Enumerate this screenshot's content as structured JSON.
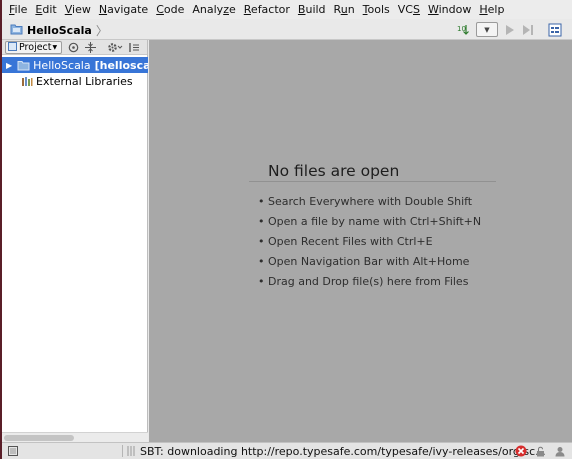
{
  "menu": [
    {
      "mnemonic": "F",
      "rest": "ile"
    },
    {
      "mnemonic": "E",
      "rest": "dit"
    },
    {
      "mnemonic": "V",
      "rest": "iew"
    },
    {
      "mnemonic": "N",
      "rest": "avigate"
    },
    {
      "mnemonic": "C",
      "rest": "ode"
    },
    {
      "pre": "Analy",
      "mnemonic": "z",
      "rest": "e"
    },
    {
      "mnemonic": "R",
      "rest": "efactor"
    },
    {
      "mnemonic": "B",
      "rest": "uild"
    },
    {
      "pre": "R",
      "mnemonic": "u",
      "rest": "n"
    },
    {
      "mnemonic": "T",
      "rest": "ools"
    },
    {
      "pre": "VC",
      "mnemonic": "S",
      "rest": ""
    },
    {
      "mnemonic": "W",
      "rest": "indow"
    },
    {
      "mnemonic": "H",
      "rest": "elp"
    }
  ],
  "navbar": {
    "breadcrumb": "HelloScala",
    "toolbar_icons": [
      "sort-icon",
      "run-config-dropdown",
      "run-icon",
      "debug-icon",
      "structure-icon"
    ]
  },
  "project_panel": {
    "view_selector": "Project",
    "tree": [
      {
        "label": "HelloScala",
        "module": "[helloscala",
        "selected": true,
        "expanded": false
      },
      {
        "label": "External Libraries",
        "selected": false
      }
    ]
  },
  "editor": {
    "title": "No files are open",
    "hints": [
      "• Search Everywhere with Double Shift",
      "• Open a file by name with Ctrl+Shift+N",
      "• Open Recent Files with Ctrl+E",
      "• Open Navigation Bar with Alt+Home",
      "• Drag and Drop file(s) here from Files"
    ]
  },
  "statusbar": {
    "message": "SBT: downloading http://repo.typesafe.com/typesafe/ivy-releases/org.sc..."
  },
  "colors": {
    "selection": "#3875d7",
    "editor_bg": "#a8a8a8",
    "window_frame": "#5a1e28",
    "error": "#d62d2d"
  }
}
